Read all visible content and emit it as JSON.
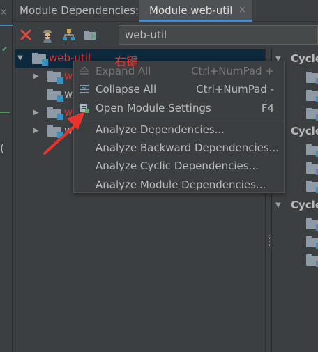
{
  "colors": {
    "background": "#3c3f41",
    "selection": "#0d293e",
    "module_red": "#e8342c",
    "accent_blue": "#4a88c7",
    "text": "#bbbbbb",
    "annotation_red": "#e8342c"
  },
  "left_strip": {
    "close_glyph": "×",
    "paren": "("
  },
  "tabs": {
    "tool_title": "Module Dependencies:",
    "active_tab": "Module web-util",
    "close_glyph": "×"
  },
  "toolbar": {
    "icons": [
      "close-red-x-icon",
      "spy-icon",
      "hierarchy-icon",
      "folder-arrow-icon"
    ],
    "search_value": "web-util"
  },
  "tree": {
    "root": {
      "label": "web-util"
    },
    "children": [
      {
        "label": "we",
        "expandable": true
      },
      {
        "label": "we",
        "expandable": false
      },
      {
        "label": "we",
        "expandable": true
      },
      {
        "label": "we",
        "expandable": true
      }
    ]
  },
  "right_panel": {
    "groups": [
      {
        "label": "Cycle"
      },
      {
        "label": "Cycle"
      },
      {
        "label": "Cycle"
      }
    ]
  },
  "context_menu": {
    "items": [
      {
        "label": "Expand All",
        "shortcut": "Ctrl+NumPad +",
        "enabled": false,
        "icon": "expand-all-icon"
      },
      {
        "label": "Collapse All",
        "shortcut": "Ctrl+NumPad -",
        "enabled": true,
        "icon": "collapse-all-icon"
      },
      {
        "label": "Open Module Settings",
        "shortcut": "F4",
        "enabled": true,
        "icon": "module-settings-icon"
      },
      {
        "label": "Analyze Dependencies...",
        "shortcut": "",
        "enabled": true
      },
      {
        "label": "Analyze Backward Dependencies...",
        "shortcut": "",
        "enabled": true
      },
      {
        "label": "Analyze Cyclic Dependencies...",
        "shortcut": "",
        "enabled": true
      },
      {
        "label": "Analyze Module Dependencies...",
        "shortcut": "",
        "enabled": true
      }
    ]
  },
  "annotation": {
    "text": "右键"
  }
}
